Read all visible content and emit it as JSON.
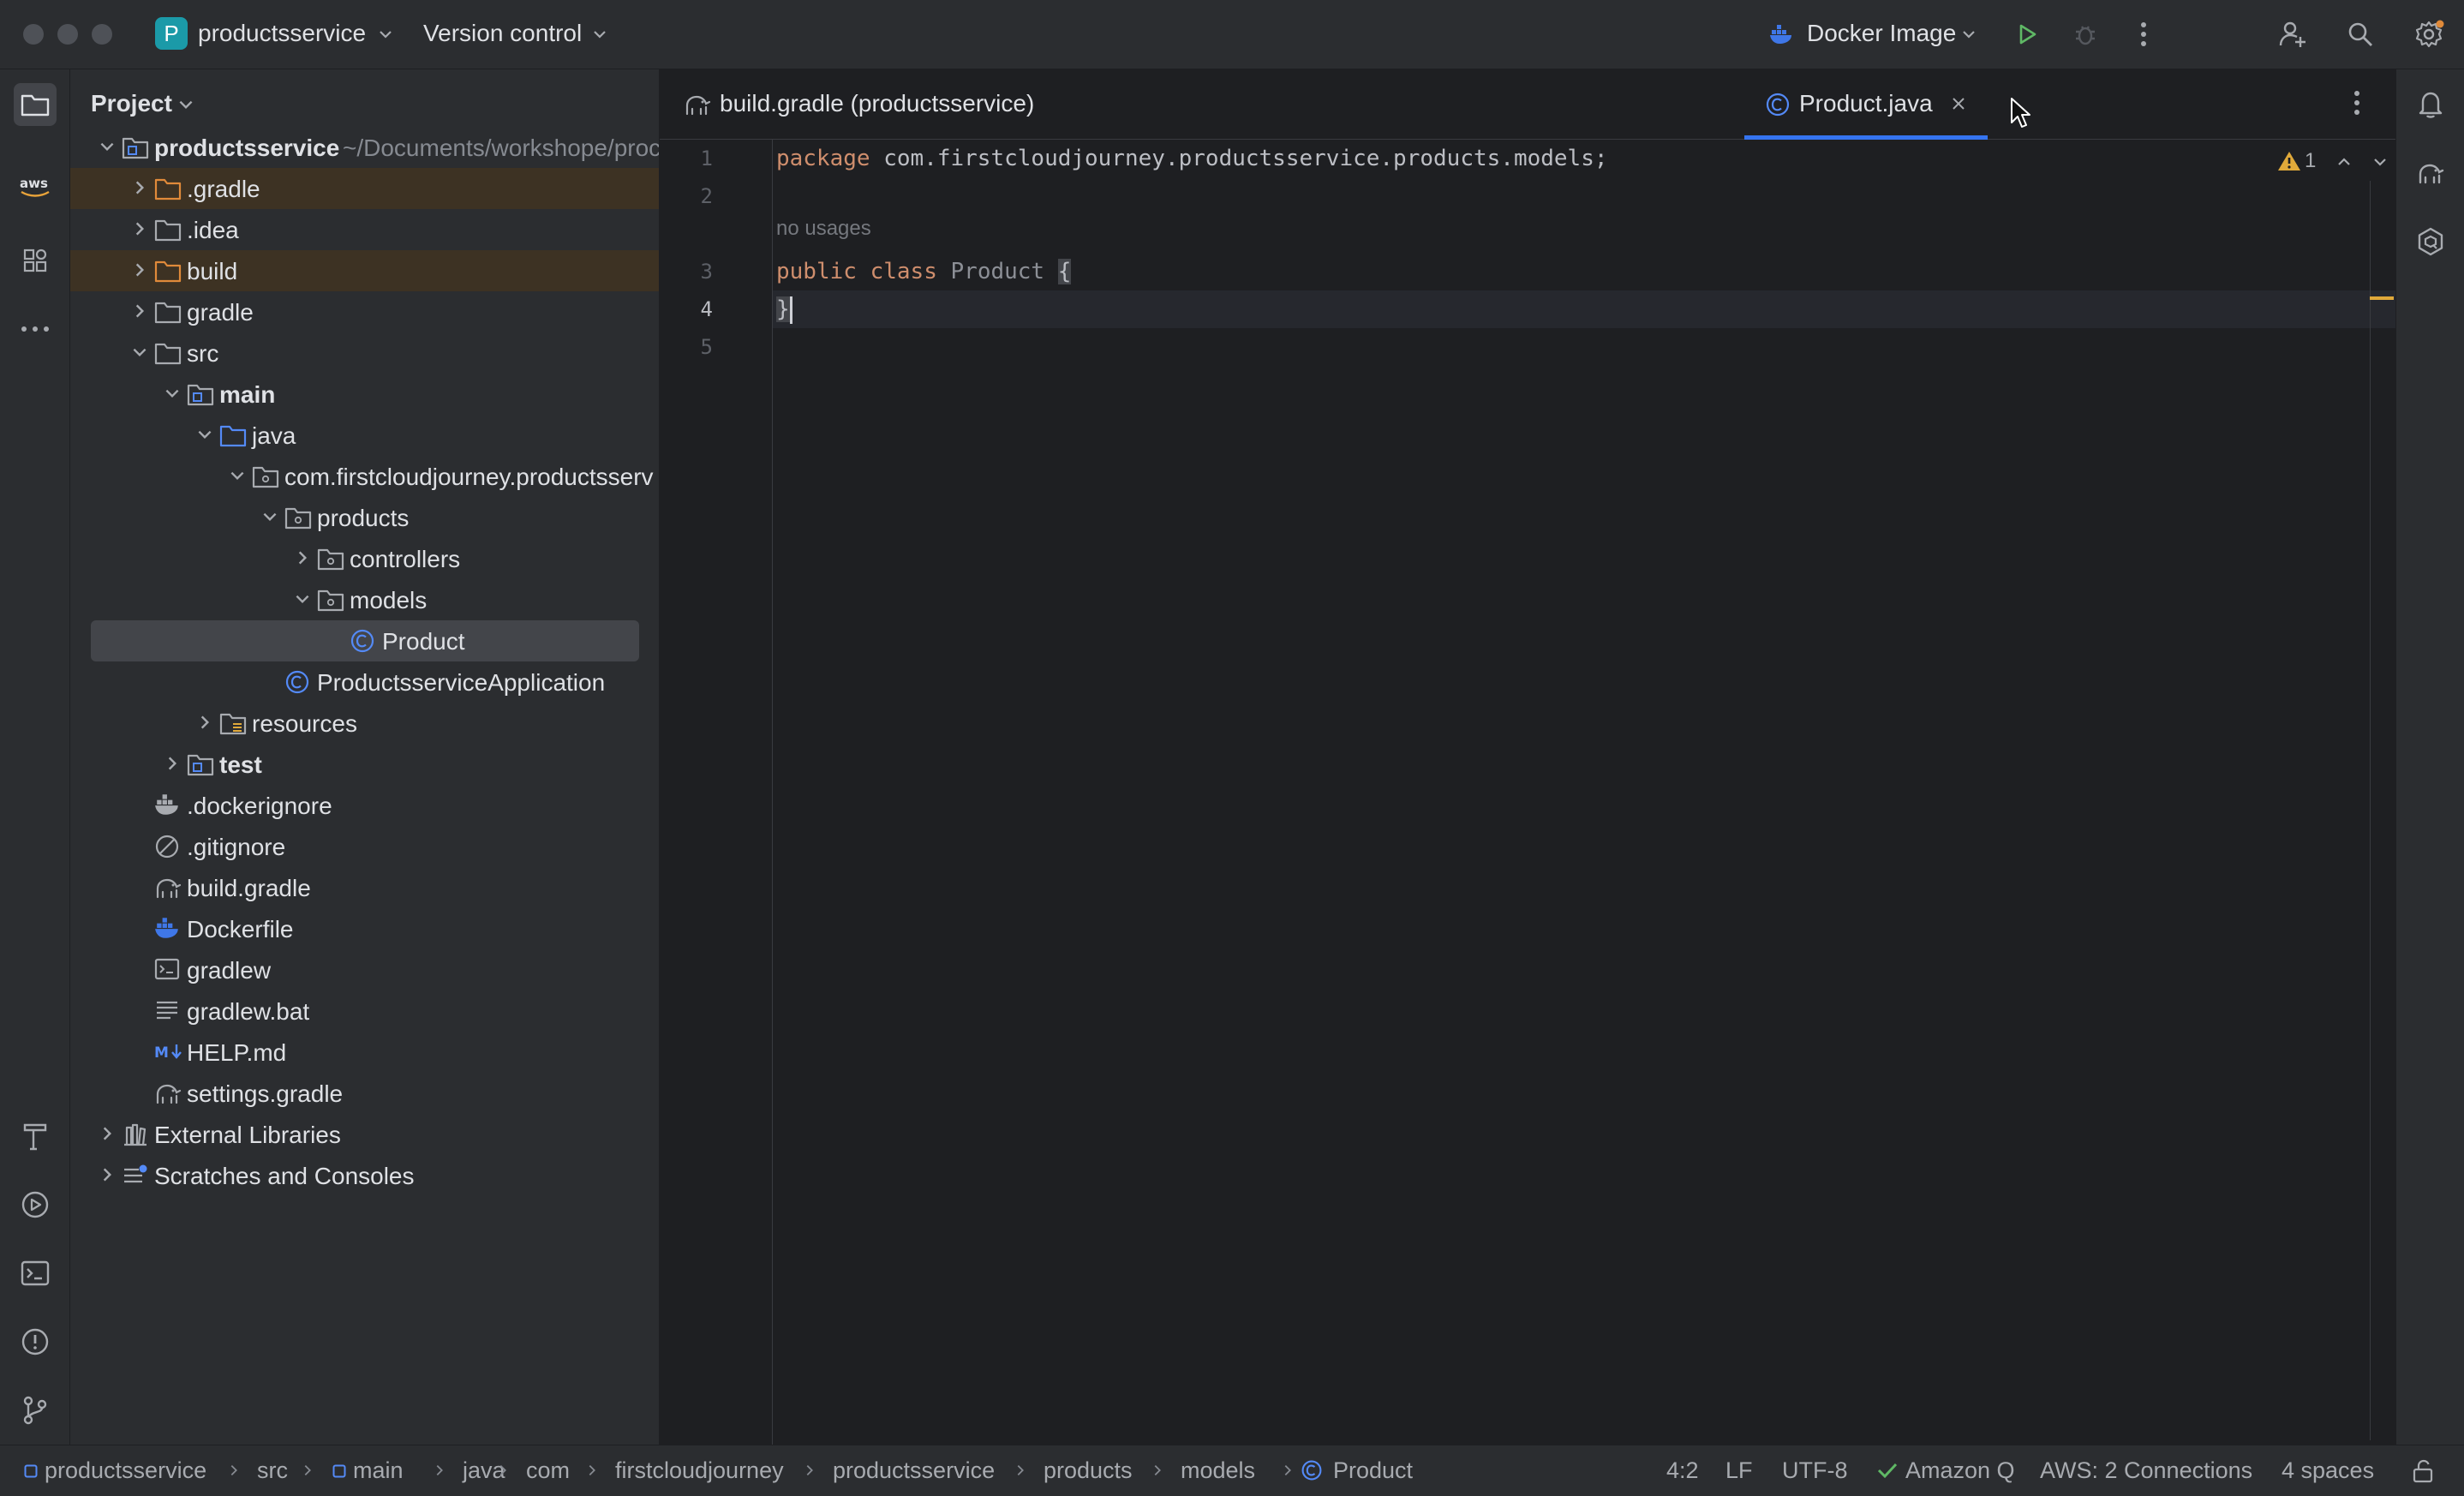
{
  "titlebar": {
    "project_badge": "P",
    "project_name": "productsservice",
    "vcs_label": "Version control",
    "run_config": "Docker Image"
  },
  "project_panel": {
    "title": "Project",
    "root_name": "productsservice",
    "root_path": "~/Documents/workshope/proc",
    "tree": [
      {
        "label": ".gradle"
      },
      {
        "label": ".idea"
      },
      {
        "label": "build"
      },
      {
        "label": "gradle"
      },
      {
        "label": "src"
      },
      {
        "label": "main"
      },
      {
        "label": "java"
      },
      {
        "label": "com.firstcloudjourney.productsserv"
      },
      {
        "label": "products"
      },
      {
        "label": "controllers"
      },
      {
        "label": "models"
      },
      {
        "label": "Product"
      },
      {
        "label": "ProductsserviceApplication"
      },
      {
        "label": "resources"
      },
      {
        "label": "test"
      },
      {
        "label": ".dockerignore"
      },
      {
        "label": ".gitignore"
      },
      {
        "label": "build.gradle"
      },
      {
        "label": "Dockerfile"
      },
      {
        "label": "gradlew"
      },
      {
        "label": "gradlew.bat"
      },
      {
        "label": "HELP.md"
      },
      {
        "label": "settings.gradle"
      },
      {
        "label": "External Libraries"
      },
      {
        "label": "Scratches and Consoles"
      }
    ]
  },
  "tabs": [
    {
      "label": "build.gradle (productsservice)"
    },
    {
      "label": "Product.java"
    }
  ],
  "editor": {
    "line_numbers": [
      "1",
      "2",
      "3",
      "4",
      "5"
    ],
    "inlay_hint": "no usages",
    "line1": {
      "keyword": "package",
      "text": " com.firstcloudjourney.productsservice.products.models;"
    },
    "line3": {
      "kw1": "public",
      "kw2": "class",
      "class_name": "Product",
      "brace": "{"
    },
    "line4": {
      "brace": "}"
    },
    "warning_count": "1"
  },
  "statusbar": {
    "breadcrumbs": [
      "productsservice",
      "src",
      "main",
      "java",
      "com",
      "firstcloudjourney",
      "productsservice",
      "products",
      "models",
      "Product"
    ],
    "position": "4:2",
    "line_sep": "LF",
    "encoding": "UTF-8",
    "amazon_q": "Amazon Q",
    "aws": "AWS: 2 Connections",
    "indent": "4 spaces"
  },
  "colors": {
    "accent": "#3574f0",
    "run_green": "#5fb865",
    "warning": "#e0a93a",
    "keyword": "#cf8e6d",
    "excluded_bg": "#3d3223"
  }
}
